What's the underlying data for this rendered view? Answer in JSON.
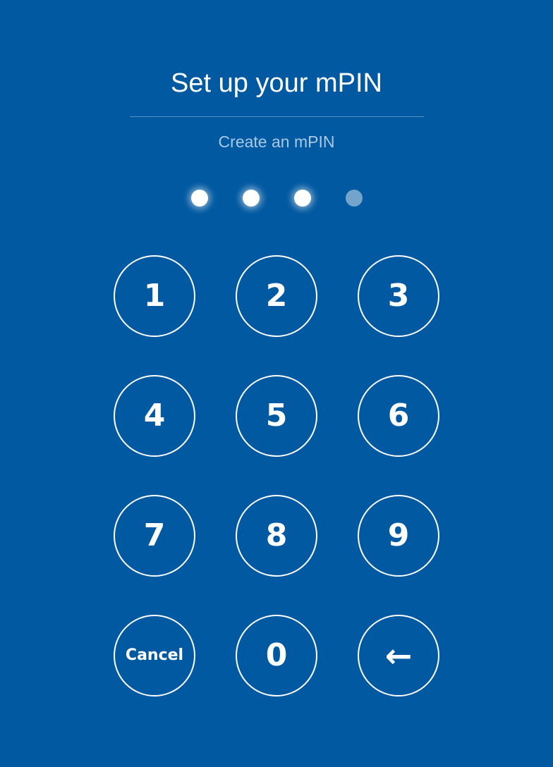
{
  "header": {
    "title": "Set up your mPIN",
    "subtitle": "Create an mPIN"
  },
  "pin": {
    "length": 4,
    "entered": 3
  },
  "keypad": {
    "keys": [
      "1",
      "2",
      "3",
      "4",
      "5",
      "6",
      "7",
      "8",
      "9",
      "Cancel",
      "0",
      "←"
    ]
  },
  "colors": {
    "background": "#0059a1",
    "text": "#ffffff",
    "subtitle": "#a9c8e6"
  },
  "icons": {
    "backspace": "left-arrow"
  }
}
